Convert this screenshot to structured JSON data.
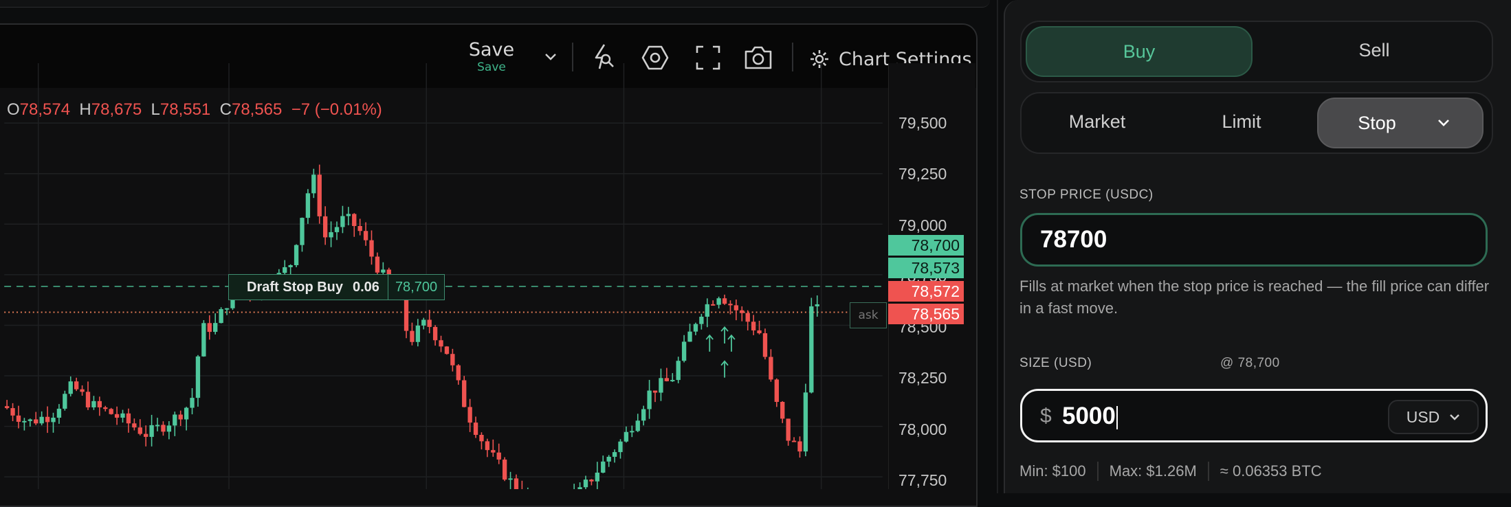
{
  "toolbar": {
    "save_label": "Save",
    "save_sub": "Save",
    "icons": [
      "chevron-down-icon",
      "lightning-cursor-icon",
      "hexagon-icon",
      "fullscreen-icon",
      "camera-icon",
      "gear-icon"
    ],
    "settings_label": "Chart Settings"
  },
  "ohlc": {
    "o_label": "O",
    "o": "78,574",
    "h_label": "H",
    "h": "78,675",
    "l_label": "L",
    "l": "78,551",
    "c_label": "C",
    "c": "78,565",
    "change": "−7 (−0.01%)"
  },
  "chart_data": {
    "type": "candlestick",
    "yticks": [
      "79,500",
      "79,250",
      "79,000",
      "78,750",
      "78,500",
      "78,250",
      "78,000",
      "77,750"
    ],
    "ylim": [
      77700,
      79600
    ],
    "price_labels": [
      {
        "value": "78,700",
        "color": "green"
      },
      {
        "value": "78,573",
        "color": "green"
      },
      {
        "value": "78,572",
        "color": "red"
      },
      {
        "value": "78,565",
        "color": "red"
      }
    ],
    "draft_order": {
      "label": "Draft Stop Buy",
      "qty": "0.06",
      "price": "78,700"
    },
    "ask_tag": "ask",
    "colors": {
      "up": "#4fc79c",
      "down": "#ef5350"
    }
  },
  "order_panel": {
    "side_tabs": [
      {
        "label": "Buy",
        "active": true
      },
      {
        "label": "Sell",
        "active": false
      }
    ],
    "type_tabs": [
      {
        "label": "Market",
        "active": false
      },
      {
        "label": "Limit",
        "active": false
      },
      {
        "label": "Stop",
        "active": true
      }
    ],
    "stop_price_label": "STOP PRICE (USDC)",
    "stop_price_value": "78700",
    "hint": "Fills at market when the stop price is reached — the fill price can differ in a fast move.",
    "size_label": "SIZE (USD)",
    "size_at": "@ 78,700",
    "currency_symbol": "$",
    "size_value": "5000",
    "size_currency": "USD",
    "min": "Min: $100",
    "max": "Max: $1.26M",
    "approx": "≈ 0.06353 BTC"
  }
}
